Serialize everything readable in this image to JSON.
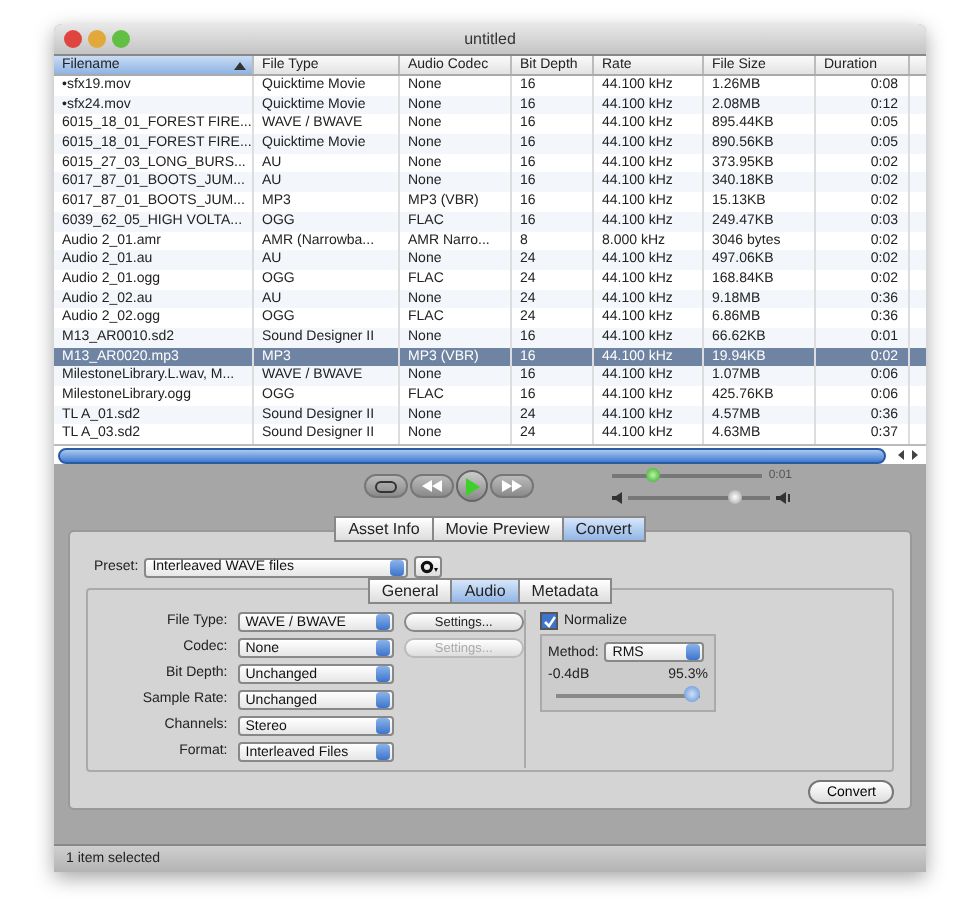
{
  "window": {
    "title": "untitled"
  },
  "table": {
    "columns": [
      {
        "label": "Filename",
        "selected": true
      },
      {
        "label": "File Type",
        "selected": false
      },
      {
        "label": "Audio Codec",
        "selected": false
      },
      {
        "label": "Bit Depth",
        "selected": false
      },
      {
        "label": "Rate",
        "selected": false
      },
      {
        "label": "File Size",
        "selected": false
      },
      {
        "label": "Duration",
        "selected": false
      }
    ],
    "rows": [
      {
        "selected": false,
        "cells": [
          "•sfx19.mov",
          "Quicktime Movie",
          "None",
          "16",
          "44.100 kHz",
          "1.26MB",
          "0:08"
        ]
      },
      {
        "selected": false,
        "cells": [
          "•sfx24.mov",
          "Quicktime Movie",
          "None",
          "16",
          "44.100 kHz",
          "2.08MB",
          "0:12"
        ]
      },
      {
        "selected": false,
        "cells": [
          "6015_18_01_FOREST FIRE...",
          "WAVE / BWAVE",
          "None",
          "16",
          "44.100 kHz",
          "895.44KB",
          "0:05"
        ]
      },
      {
        "selected": false,
        "cells": [
          "6015_18_01_FOREST FIRE...",
          "Quicktime Movie",
          "None",
          "16",
          "44.100 kHz",
          "890.56KB",
          "0:05"
        ]
      },
      {
        "selected": false,
        "cells": [
          "6015_27_03_LONG_BURS...",
          "AU",
          "None",
          "16",
          "44.100 kHz",
          "373.95KB",
          "0:02"
        ]
      },
      {
        "selected": false,
        "cells": [
          "6017_87_01_BOOTS_JUM...",
          "AU",
          "None",
          "16",
          "44.100 kHz",
          "340.18KB",
          "0:02"
        ]
      },
      {
        "selected": false,
        "cells": [
          "6017_87_01_BOOTS_JUM...",
          "MP3",
          "MP3 (VBR)",
          "16",
          "44.100 kHz",
          "15.13KB",
          "0:02"
        ]
      },
      {
        "selected": false,
        "cells": [
          "6039_62_05_HIGH VOLTA...",
          "OGG",
          "FLAC",
          "16",
          "44.100 kHz",
          "249.47KB",
          "0:03"
        ]
      },
      {
        "selected": false,
        "cells": [
          "Audio 2_01.amr",
          "AMR (Narrowba...",
          "AMR Narro...",
          "8",
          "8.000 kHz",
          "3046 bytes",
          "0:02"
        ]
      },
      {
        "selected": false,
        "cells": [
          "Audio 2_01.au",
          "AU",
          "None",
          "24",
          "44.100 kHz",
          "497.06KB",
          "0:02"
        ]
      },
      {
        "selected": false,
        "cells": [
          "Audio 2_01.ogg",
          "OGG",
          "FLAC",
          "24",
          "44.100 kHz",
          "168.84KB",
          "0:02"
        ]
      },
      {
        "selected": false,
        "cells": [
          "Audio 2_02.au",
          "AU",
          "None",
          "24",
          "44.100 kHz",
          "9.18MB",
          "0:36"
        ]
      },
      {
        "selected": false,
        "cells": [
          "Audio 2_02.ogg",
          "OGG",
          "FLAC",
          "24",
          "44.100 kHz",
          "6.86MB",
          "0:36"
        ]
      },
      {
        "selected": false,
        "cells": [
          "M13_AR0010.sd2",
          "Sound Designer II",
          "None",
          "16",
          "44.100 kHz",
          "66.62KB",
          "0:01"
        ]
      },
      {
        "selected": true,
        "cells": [
          "M13_AR0020.mp3",
          "MP3",
          "MP3 (VBR)",
          "16",
          "44.100 kHz",
          "19.94KB",
          "0:02"
        ]
      },
      {
        "selected": false,
        "cells": [
          "MilestoneLibrary.L.wav, M...",
          "WAVE / BWAVE",
          "None",
          "16",
          "44.100 kHz",
          "1.07MB",
          "0:06"
        ]
      },
      {
        "selected": false,
        "cells": [
          "MilestoneLibrary.ogg",
          "OGG",
          "FLAC",
          "16",
          "44.100 kHz",
          "425.76KB",
          "0:06"
        ]
      },
      {
        "selected": false,
        "cells": [
          "TL A_01.sd2",
          "Sound Designer II",
          "None",
          "24",
          "44.100 kHz",
          "4.57MB",
          "0:36"
        ]
      },
      {
        "selected": false,
        "cells": [
          "TL A_03.sd2",
          "Sound Designer II",
          "None",
          "24",
          "44.100 kHz",
          "4.63MB",
          "0:37"
        ]
      }
    ]
  },
  "player": {
    "position": {
      "level": 0.27
    },
    "time": "0:01",
    "volume": {
      "level": 0.75
    }
  },
  "tabs": [
    {
      "label": "Asset Info",
      "selected": false
    },
    {
      "label": "Movie Preview",
      "selected": false
    },
    {
      "label": "Convert",
      "selected": true
    }
  ],
  "preset": {
    "label": "Preset:",
    "value": "Interleaved WAVE files"
  },
  "subtabs": [
    {
      "label": "General",
      "selected": false
    },
    {
      "label": "Audio",
      "selected": true
    },
    {
      "label": "Metadata",
      "selected": false
    }
  ],
  "fields": [
    {
      "label": "File Type:",
      "value": "WAVE / BWAVE",
      "button": {
        "label": "Settings...",
        "disabled": false
      }
    },
    {
      "label": "Codec:",
      "value": "None",
      "button": {
        "label": "Settings...",
        "disabled": true
      }
    },
    {
      "label": "Bit Depth:",
      "value": "Unchanged"
    },
    {
      "label": "Sample Rate:",
      "value": "Unchanged"
    },
    {
      "label": "Channels:",
      "value": "Stereo"
    },
    {
      "label": "Format:",
      "value": "Interleaved Files"
    }
  ],
  "normalize": {
    "label": "Normalize",
    "checked": true,
    "method_label": "Method:",
    "method": "RMS",
    "min": "-0.4dB",
    "max": "95.3%",
    "level": 0.95
  },
  "convert_button": "Convert",
  "status_bar": "1 item selected"
}
